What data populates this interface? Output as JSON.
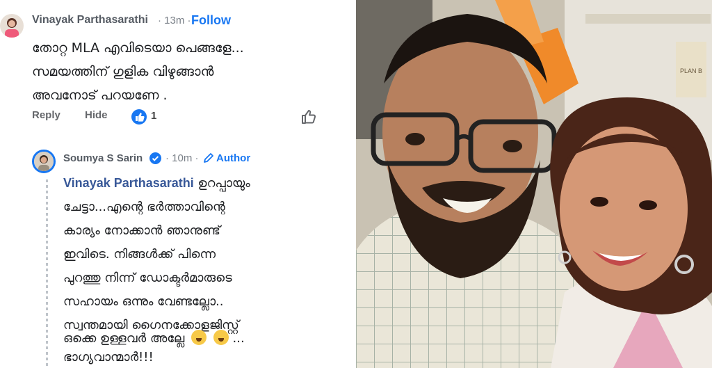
{
  "comment": {
    "author": "Vinayak Parthasarathi",
    "time": "· 13m ·",
    "follow_label": "Follow",
    "lines": [
      "തോറ്റ MLA എവിടെയാ പെങ്ങളേ...",
      "സമയത്തിന് ഗുളിക വിഴുങ്ങാൻ",
      "അവനോട് പറയണേ ."
    ],
    "actions": {
      "reply": "Reply",
      "hide": "Hide",
      "like_count": "1"
    }
  },
  "reply": {
    "author": "Soumya S Sarin",
    "time": "· 10m ·",
    "badge_label": "Author",
    "mention": "Vinayak Parthasarathi",
    "first_line_rest": " ഉറപ്പായും",
    "lines": [
      "ചേട്ടാ...എന്റെ ഭർത്താവിന്റെ",
      "കാര്യം നോക്കാൻ ഞാനുണ്ട്",
      "ഇവിടെ. നിങ്ങൾക്ക് പിന്നെ",
      "പുറത്തു നിന്ന് ഡോക്ടർമാരുടെ",
      "സഹായം ഒന്നും വേണ്ടല്ലോ..",
      "സ്വന്തമായി ഗൈനക്കോളജിസ്റ്റ്",
      "ഒക്കെ ഉള്ളവർ അല്ലേ",
      "ഭാഗ്യവാന്മാർ!!!"
    ],
    "line7_tail": "..."
  },
  "photo": {
    "sign_text": "PLAN B"
  },
  "colors": {
    "link": "#1877f2",
    "mention": "#385898",
    "name": "#555b63",
    "meta": "#7a8088"
  },
  "icons": [
    "avatar-woman",
    "like-reaction-icon",
    "thumbs-up-icon",
    "verified-badge-icon",
    "pencil-icon",
    "laughing-emoji-icon"
  ]
}
